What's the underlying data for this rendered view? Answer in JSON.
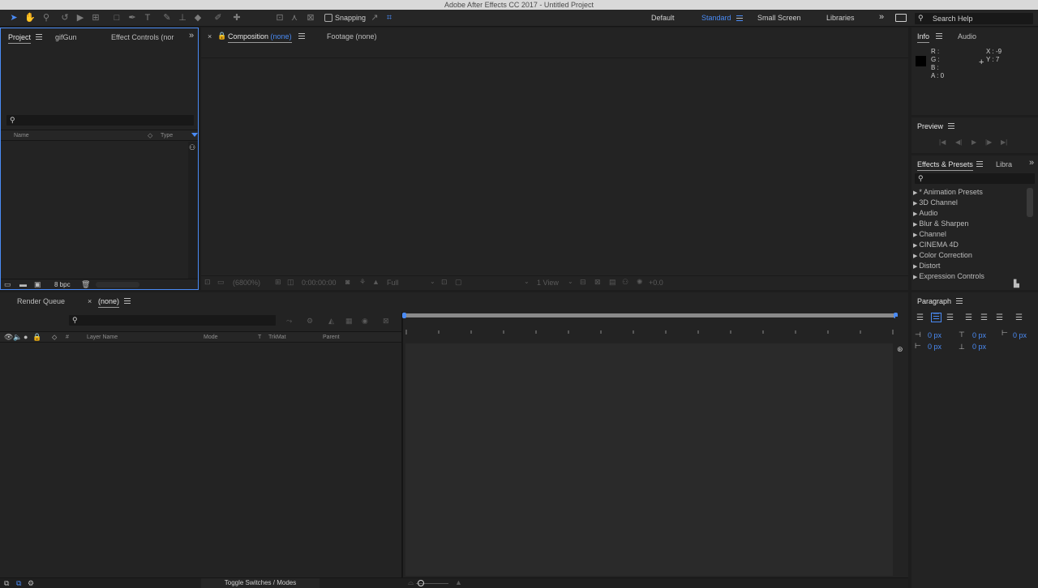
{
  "app": {
    "title": "Adobe After Effects CC 2017 - Untitled Project"
  },
  "toolbar": {
    "snapping_label": "Snapping",
    "workspaces": [
      "Default",
      "Standard",
      "Small Screen",
      "Libraries"
    ],
    "active_workspace": "Standard",
    "search_help": "Search Help",
    "more_glyph": "»"
  },
  "project_panel": {
    "tabs": [
      "Project",
      "gifGun",
      "Effect Controls (nor"
    ],
    "columns": {
      "name": "Name",
      "type": "Type"
    },
    "bpc": "8 bpc",
    "more_glyph": "»"
  },
  "composition_panel": {
    "tabs": {
      "composition_prefix": "Composition",
      "composition_name": "(none)",
      "footage": "Footage (none)"
    },
    "close_glyph": "×",
    "footer": {
      "zoom": "(6800%)",
      "timecode": "0:00:00:00",
      "resolution": "Full",
      "view": "1 View",
      "exposure": "+0.0"
    }
  },
  "info_panel": {
    "tabs": [
      "Info",
      "Audio"
    ],
    "r": "R :",
    "g": "G :",
    "b": "B :",
    "a": "A : 0",
    "x": "X : -9",
    "y": "Y : 7",
    "crosshair": "+"
  },
  "preview_panel": {
    "title": "Preview"
  },
  "effects_panel": {
    "tabs": [
      "Effects & Presets",
      "Libra"
    ],
    "items": [
      "* Animation Presets",
      "3D Channel",
      "Audio",
      "Blur & Sharpen",
      "Channel",
      "CINEMA 4D",
      "Color Correction",
      "Distort",
      "Expression Controls"
    ],
    "more_glyph": "»"
  },
  "timeline_panel": {
    "tabs": {
      "render_queue": "Render Queue",
      "comp": "(none)"
    },
    "close_glyph": "×",
    "columns": {
      "hash": "#",
      "layer_name": "Layer Name",
      "mode": "Mode",
      "t": "T",
      "trkmat": "TrkMat",
      "parent": "Parent"
    },
    "footer_toggle": "Toggle Switches / Modes"
  },
  "paragraph_panel": {
    "title": "Paragraph",
    "indent_left": "0 px",
    "indent_right": "0 px",
    "first_line": "0 px",
    "space_before": "0 px",
    "space_after": "0 px"
  }
}
